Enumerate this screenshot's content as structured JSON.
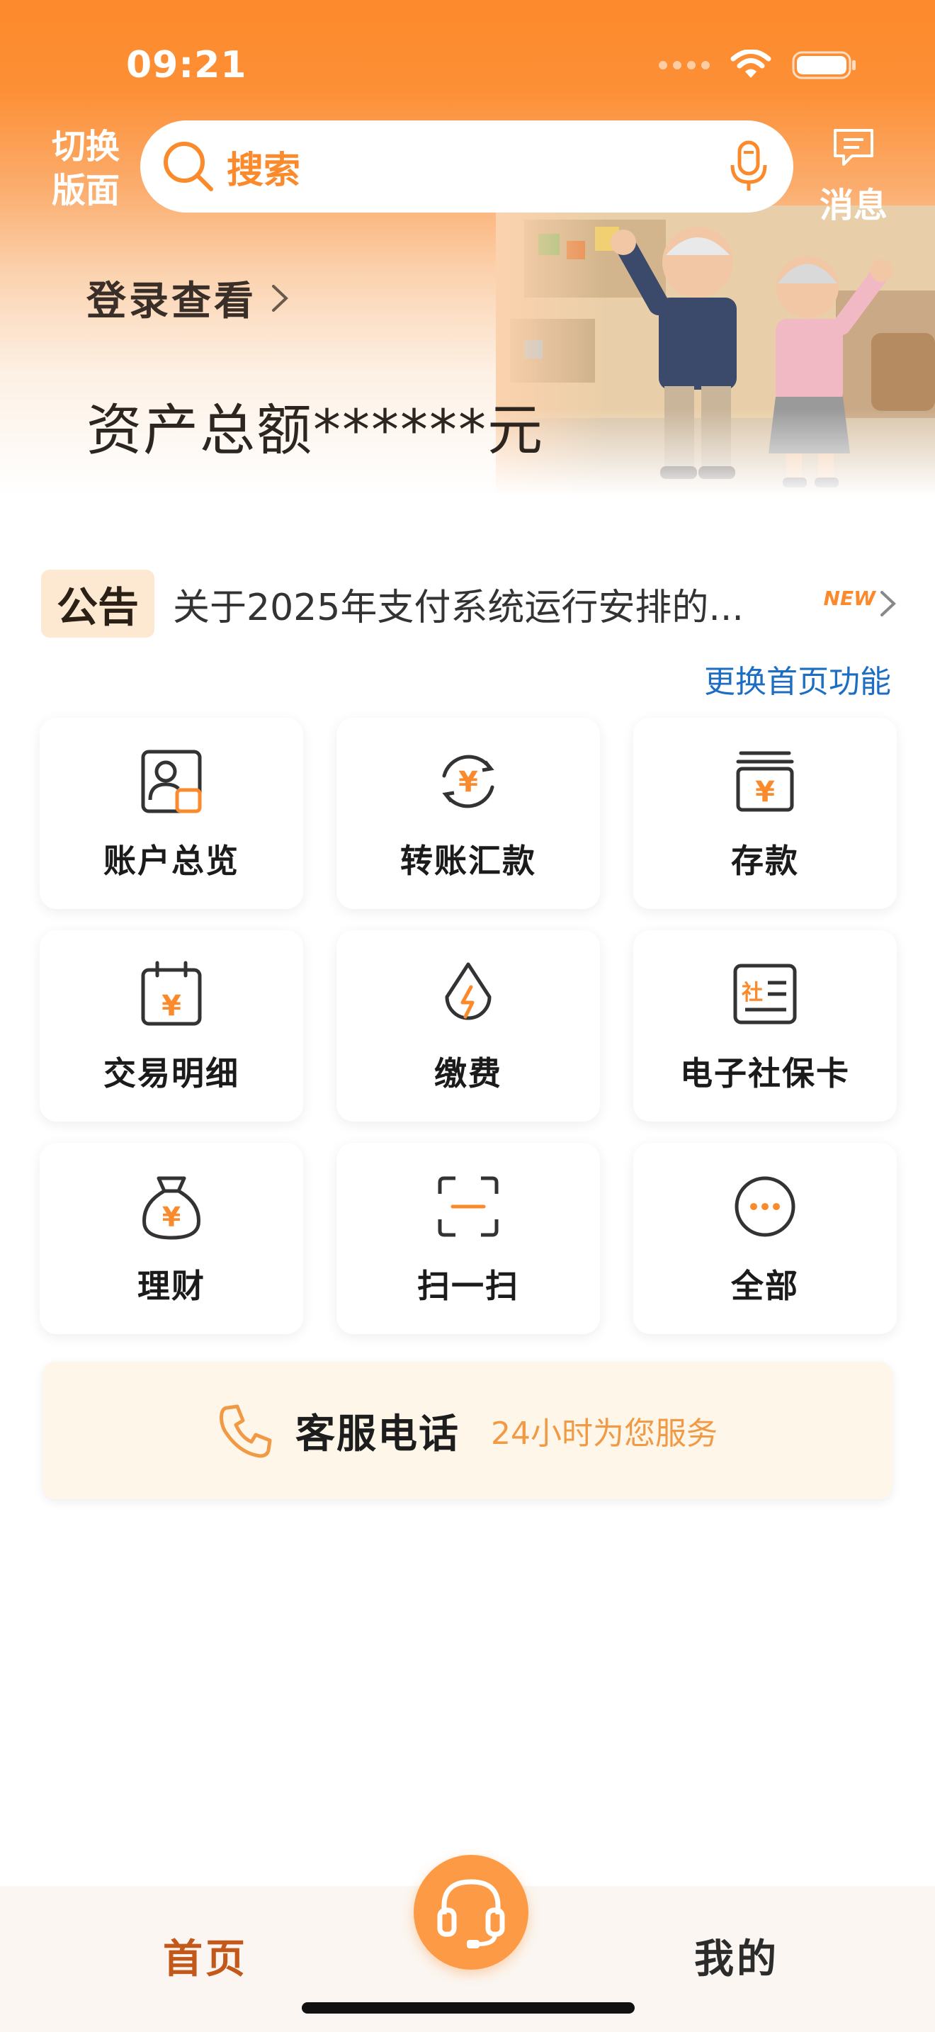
{
  "status": {
    "time": "09:21"
  },
  "header": {
    "switch_label": "切换版面",
    "search_placeholder": "搜索",
    "message_label": "消息"
  },
  "hero": {
    "login_label": "登录查看",
    "assets_label": "资产总额******元"
  },
  "notice": {
    "tag": "公告",
    "text": "关于2025年支付系统运行安排的...",
    "badge": "NEW"
  },
  "change_link": "更换首页功能",
  "functions": [
    {
      "label": "账户总览",
      "icon": "account-overview-icon"
    },
    {
      "label": "转账汇款",
      "icon": "transfer-icon"
    },
    {
      "label": "存款",
      "icon": "deposit-icon"
    },
    {
      "label": "交易明细",
      "icon": "transaction-detail-icon"
    },
    {
      "label": "缴费",
      "icon": "payment-icon"
    },
    {
      "label": "电子社保卡",
      "icon": "social-security-card-icon"
    },
    {
      "label": "理财",
      "icon": "wealth-icon"
    },
    {
      "label": "扫一扫",
      "icon": "scan-icon"
    },
    {
      "label": "全部",
      "icon": "more-icon"
    }
  ],
  "service": {
    "title": "客服电话",
    "subtitle": "24小时为您服务"
  },
  "bottom_nav": {
    "home": "首页",
    "mine": "我的"
  },
  "colors": {
    "brand_orange": "#fd8a2c",
    "link_blue": "#1d6ec2",
    "icon_dark": "#333333"
  }
}
